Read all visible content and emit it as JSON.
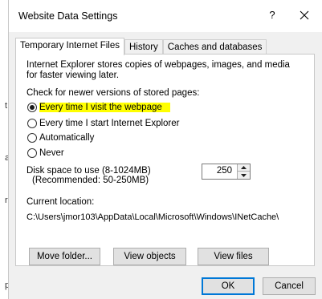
{
  "dialog": {
    "title": "Website Data Settings",
    "help_label": "?",
    "close_icon": "close-icon"
  },
  "background_letters": [
    "t",
    "a",
    "r",
    "p"
  ],
  "tabs": [
    {
      "label": "Temporary Internet Files",
      "active": true
    },
    {
      "label": "History",
      "active": false
    },
    {
      "label": "Caches and databases",
      "active": false
    }
  ],
  "panel": {
    "description_line1": "Internet Explorer stores copies of webpages, images, and media",
    "description_line2": "for faster viewing later.",
    "check_label": "Check for newer versions of stored pages:",
    "radio_options": [
      {
        "label": "Every time I visit the webpage",
        "checked": true,
        "highlighted": true
      },
      {
        "label": "Every time I start Internet Explorer",
        "checked": false
      },
      {
        "label": "Automatically",
        "checked": false
      },
      {
        "label": "Never",
        "checked": false
      }
    ],
    "disk_label_line1": "Disk space to use (8-1024MB)",
    "disk_label_line2": "(Recommended: 50-250MB)",
    "disk_value": "250",
    "location_label": "Current location:",
    "location_path": "C:\\Users\\jmor103\\AppData\\Local\\Microsoft\\Windows\\INetCache\\",
    "buttons": {
      "move_folder": "Move folder...",
      "view_objects": "View objects",
      "view_files": "View files"
    }
  },
  "footer": {
    "ok_label": "OK",
    "cancel_label": "Cancel"
  },
  "colors": {
    "highlight": "#ffff00",
    "accent": "#0078d7"
  }
}
